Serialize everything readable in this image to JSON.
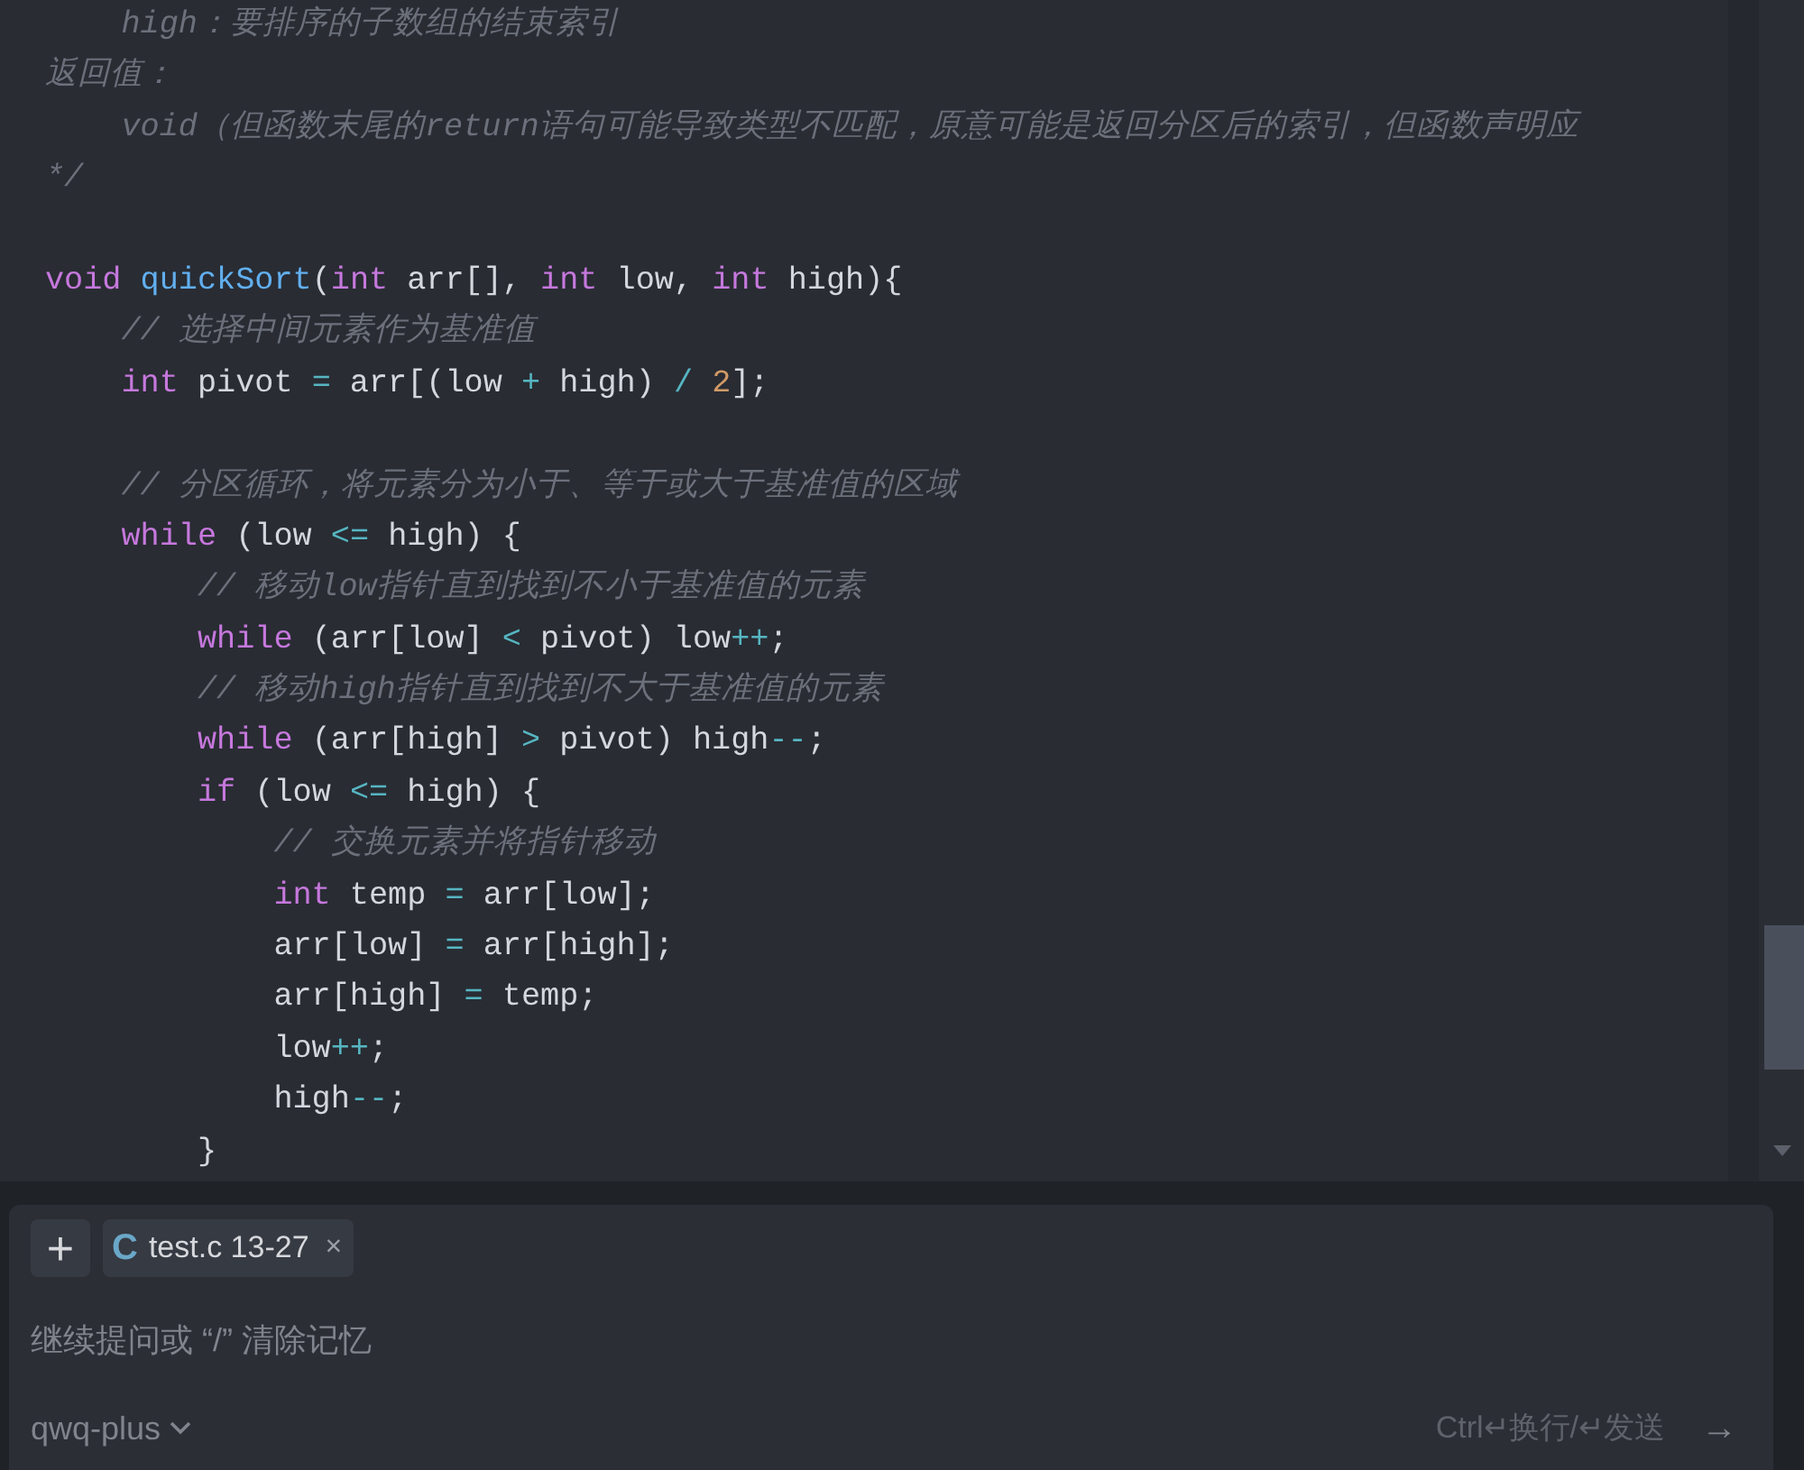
{
  "code_lines": [
    {
      "kind": "code",
      "tokens": [
        {
          "kind": "comment",
          "text": "    high：要排序的子数组的结束索引"
        }
      ]
    },
    {
      "kind": "code",
      "tokens": [
        {
          "kind": "comment",
          "text": "返回值："
        }
      ]
    },
    {
      "kind": "code",
      "tokens": [
        {
          "kind": "comment",
          "text": "    void（但函数末尾的return语句可能导致类型不匹配，原意可能是返回分区后的索引，但函数声明应"
        }
      ]
    },
    {
      "kind": "code",
      "tokens": [
        {
          "kind": "comment",
          "text": "*/"
        }
      ]
    },
    {
      "kind": "blank"
    },
    {
      "kind": "code",
      "tokens": [
        {
          "kind": "keyword",
          "text": "void"
        },
        {
          "kind": "function",
          "text": " quickSort"
        },
        {
          "kind": "plain",
          "text": "("
        },
        {
          "kind": "keyword",
          "text": "int"
        },
        {
          "kind": "plain",
          "text": " arr[], "
        },
        {
          "kind": "keyword",
          "text": "int"
        },
        {
          "kind": "plain",
          "text": " low, "
        },
        {
          "kind": "keyword",
          "text": "int"
        },
        {
          "kind": "plain",
          "text": " high){"
        }
      ]
    },
    {
      "kind": "code",
      "tokens": [
        {
          "kind": "comment",
          "text": "    // 选择中间元素作为基准值"
        }
      ]
    },
    {
      "kind": "code",
      "tokens": [
        {
          "kind": "keyword",
          "text": "    int"
        },
        {
          "kind": "plain",
          "text": " pivot "
        },
        {
          "kind": "operator",
          "text": "="
        },
        {
          "kind": "plain",
          "text": " arr[(low "
        },
        {
          "kind": "operator",
          "text": "+"
        },
        {
          "kind": "plain",
          "text": " high) "
        },
        {
          "kind": "operator",
          "text": "/ "
        },
        {
          "kind": "number",
          "text": "2"
        },
        {
          "kind": "plain",
          "text": "];"
        }
      ]
    },
    {
      "kind": "blank"
    },
    {
      "kind": "code",
      "tokens": [
        {
          "kind": "comment",
          "text": "    // 分区循环，将元素分为小于、等于或大于基准值的区域"
        }
      ]
    },
    {
      "kind": "code",
      "tokens": [
        {
          "kind": "keyword",
          "text": "    while"
        },
        {
          "kind": "plain",
          "text": " (low "
        },
        {
          "kind": "operator",
          "text": "<="
        },
        {
          "kind": "plain",
          "text": " high) {"
        }
      ]
    },
    {
      "kind": "code",
      "tokens": [
        {
          "kind": "comment",
          "text": "        // 移动low指针直到找到不小于基准值的元素"
        }
      ]
    },
    {
      "kind": "code",
      "tokens": [
        {
          "kind": "keyword",
          "text": "        while"
        },
        {
          "kind": "plain",
          "text": " (arr[low] "
        },
        {
          "kind": "operator",
          "text": "<"
        },
        {
          "kind": "plain",
          "text": " pivot) low"
        },
        {
          "kind": "operator",
          "text": "++"
        },
        {
          "kind": "plain",
          "text": ";"
        }
      ]
    },
    {
      "kind": "code",
      "tokens": [
        {
          "kind": "comment",
          "text": "        // 移动high指针直到找到不大于基准值的元素"
        }
      ]
    },
    {
      "kind": "code",
      "tokens": [
        {
          "kind": "keyword",
          "text": "        while"
        },
        {
          "kind": "plain",
          "text": " (arr[high] "
        },
        {
          "kind": "operator",
          "text": ">"
        },
        {
          "kind": "plain",
          "text": " pivot) high"
        },
        {
          "kind": "operator",
          "text": "--"
        },
        {
          "kind": "plain",
          "text": ";"
        }
      ]
    },
    {
      "kind": "code",
      "tokens": [
        {
          "kind": "keyword",
          "text": "        if"
        },
        {
          "kind": "plain",
          "text": " (low "
        },
        {
          "kind": "operator",
          "text": "<="
        },
        {
          "kind": "plain",
          "text": " high) {"
        }
      ]
    },
    {
      "kind": "code",
      "tokens": [
        {
          "kind": "comment",
          "text": "            // 交换元素并将指针移动"
        }
      ]
    },
    {
      "kind": "code",
      "tokens": [
        {
          "kind": "keyword",
          "text": "            int"
        },
        {
          "kind": "plain",
          "text": " temp "
        },
        {
          "kind": "operator",
          "text": "="
        },
        {
          "kind": "plain",
          "text": " arr[low];"
        }
      ]
    },
    {
      "kind": "code",
      "tokens": [
        {
          "kind": "plain",
          "text": "            arr[low] "
        },
        {
          "kind": "operator",
          "text": "="
        },
        {
          "kind": "plain",
          "text": " arr[high];"
        }
      ]
    },
    {
      "kind": "code",
      "tokens": [
        {
          "kind": "plain",
          "text": "            arr[high] "
        },
        {
          "kind": "operator",
          "text": "="
        },
        {
          "kind": "plain",
          "text": " temp;"
        }
      ]
    },
    {
      "kind": "code",
      "tokens": [
        {
          "kind": "plain",
          "text": "            low"
        },
        {
          "kind": "operator",
          "text": "++"
        },
        {
          "kind": "plain",
          "text": ";"
        }
      ]
    },
    {
      "kind": "code",
      "tokens": [
        {
          "kind": "plain",
          "text": "            high"
        },
        {
          "kind": "operator",
          "text": "--"
        },
        {
          "kind": "plain",
          "text": ";"
        }
      ]
    },
    {
      "kind": "code",
      "tokens": [
        {
          "kind": "plain",
          "text": "        }"
        }
      ]
    }
  ],
  "input_panel": {
    "add_button": "+",
    "context_chip": {
      "icon_letter": "C",
      "label": "test.c 13-27",
      "close": "×"
    },
    "placeholder": "继续提问或 “/” 清除记忆",
    "model": "qwq-plus",
    "hint": "Ctrl↵换行/↵发送",
    "send": "→"
  }
}
